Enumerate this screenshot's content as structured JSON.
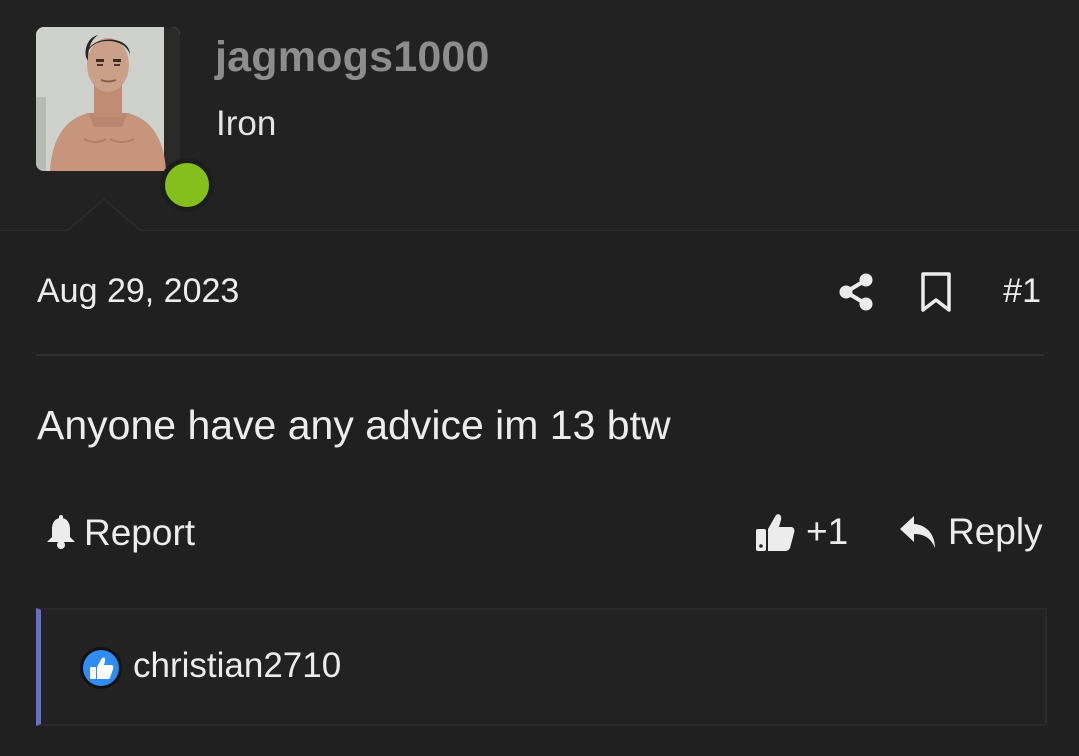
{
  "user": {
    "name": "jagmogs1000",
    "title": "Iron",
    "status": "online",
    "status_color": "#84bf1c"
  },
  "post": {
    "date": "Aug 29, 2023",
    "number": "#1",
    "body": "Anyone have any advice im 13 btw"
  },
  "actions": {
    "report_label": "Report",
    "like_count": "+1",
    "reply_label": "Reply"
  },
  "icons": {
    "share": "share-icon",
    "bookmark": "bookmark-icon",
    "report": "bell-icon",
    "like": "thumbs-up-icon",
    "reply": "reply-arrow-icon",
    "reaction": "like-reaction-icon"
  },
  "reactions": {
    "users": [
      "christian2710"
    ],
    "accent_color": "#6770c8"
  }
}
